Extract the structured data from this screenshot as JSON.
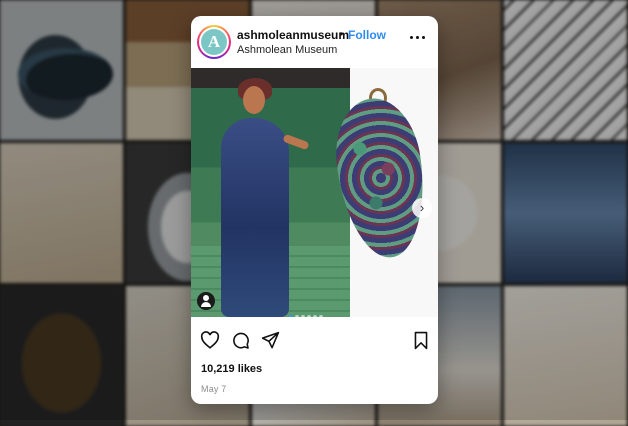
{
  "post": {
    "username": "ashmoleanmuseum",
    "separator": "•",
    "follow_label": "Follow",
    "subtitle": "Ashmolean Museum",
    "avatar_letter": "A",
    "likes": "10,219 likes",
    "date": "May 7"
  },
  "carousel": {
    "slide_count": 6,
    "active_index": 0
  },
  "icons": {
    "more": "more-options-icon",
    "heart": "heart-icon",
    "comment": "comment-icon",
    "share": "share-icon",
    "bookmark": "bookmark-icon",
    "next": "chevron-right-icon",
    "tag": "user-tag-icon"
  },
  "colors": {
    "follow": "#2f8cf0",
    "card_bg": "#ffffff",
    "text": "#111111",
    "meta": "#8e8e8e"
  }
}
